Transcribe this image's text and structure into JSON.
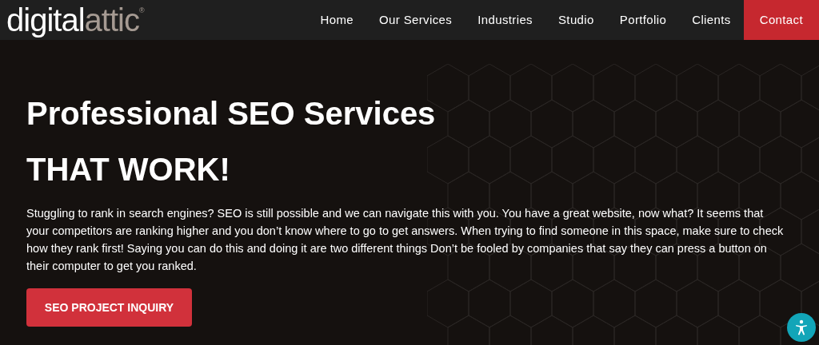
{
  "logo": {
    "primary": "digital",
    "secondary": "attic",
    "mark": "®"
  },
  "nav": [
    {
      "label": "Home",
      "kind": "link"
    },
    {
      "label": "Our Services",
      "kind": "link"
    },
    {
      "label": "Industries",
      "kind": "link"
    },
    {
      "label": "Studio",
      "kind": "link"
    },
    {
      "label": "Portfolio",
      "kind": "link"
    },
    {
      "label": "Clients",
      "kind": "link"
    },
    {
      "label": "Contact",
      "kind": "cta"
    }
  ],
  "hero": {
    "title": "Professional SEO Services",
    "subtitle": "THAT WORK!",
    "body": "Stuggling to rank in search engines? SEO is still possible and we can navigate this with you. You have a great website, now what? It seems that your competitors are ranking higher and you don’t know where to go to get answers. When trying to find someone in this space, make sure to check how they rank first! Saying you can do this and doing it are two different things Don’t be fooled by companies that say they can press a button on their computer to get you ranked.",
    "button": "SEO PROJECT INQUIRY"
  }
}
